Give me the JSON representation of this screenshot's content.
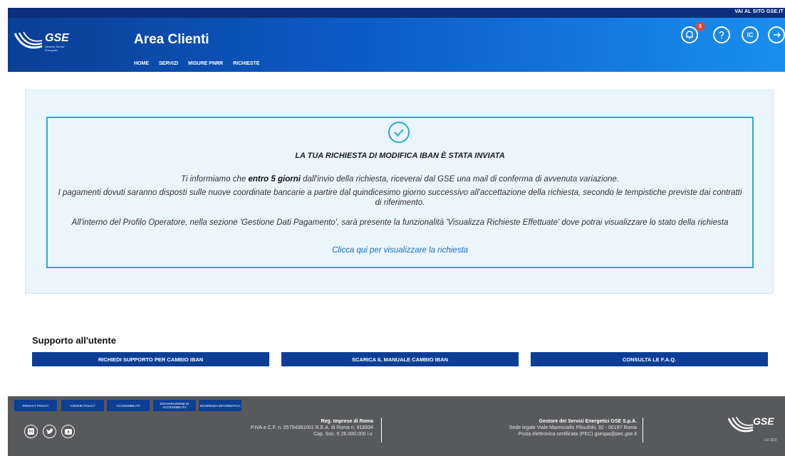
{
  "topbar": {
    "link": "VAI AL SITO GSE.IT"
  },
  "header": {
    "logo_text": "GSE",
    "logo_sub": "Gestore Servizi Energetici",
    "title": "Area Clienti",
    "nav": [
      "HOME",
      "SERVIZI",
      "MISURE PNRR",
      "RICHIESTE"
    ],
    "notification_count": "5",
    "user_initials": "IC",
    "icons": [
      "bell-icon",
      "help-icon",
      "user-avatar",
      "logout-icon"
    ]
  },
  "message": {
    "title": "LA TUA RICHIESTA DI MODIFICA IBAN È STATA INVIATA",
    "p1_a": "Ti informiamo che ",
    "p1_b": "entro 5 giorni",
    "p1_c": " dall'invio della richiesta, riceverai dal GSE una mail di conferma di avvenuta variazione.",
    "p2": "I pagamenti dovuti saranno disposti sulle nuove coordinate bancarie a partire dal quindicesimo giorno successivo all'accettazione della richiesta, secondo le tempistiche previste dai contratti di riferimento.",
    "p3": "All'interno del Profilo Operatore, nella sezione 'Gestione Dati Pagamento', sarà presente la funzionalità 'Visualizza Richieste Effettuate' dove potrai visualizzare lo stato della richiesta",
    "link": "Clicca qui per visualizzare la richiesta"
  },
  "support": {
    "title": "Supporto all'utente",
    "buttons": [
      "RICHIEDI SUPPORTO PER CAMBIO IBAN",
      "SCARICA IL MANUALE CAMBIO IBAN",
      "CONSULTA LE F.A.Q."
    ]
  },
  "footer": {
    "links": [
      "PRIVACY POLICY",
      "COOKIE POLICY",
      "ACCESSIBILITÀ",
      "DICHIARAZIONE DI ACCESSIBILITÀ",
      "SICUREZZA INFORMATICA"
    ],
    "reg_title": "Reg. Imprese di Roma",
    "reg_line1": "P.IVA e C.F. n. 05754381001 R.E.A. di Roma n. 918934",
    "reg_line2": "Cap. Soc. € 26.000.000 i.v.",
    "company_title": "Gestore dei Servizi Energetici GSE S.p.A.",
    "company_line1": "Sede legale Viale Maresciallo Pilsudski, 92 - 00197 Roma",
    "company_line2": "Posta elettronica certificata (PEC) gsespa@pec.gse.it",
    "logo_text": "GSE",
    "version": "v.2.10.0",
    "social": [
      "linkedin-icon",
      "twitter-icon",
      "youtube-icon"
    ]
  }
}
